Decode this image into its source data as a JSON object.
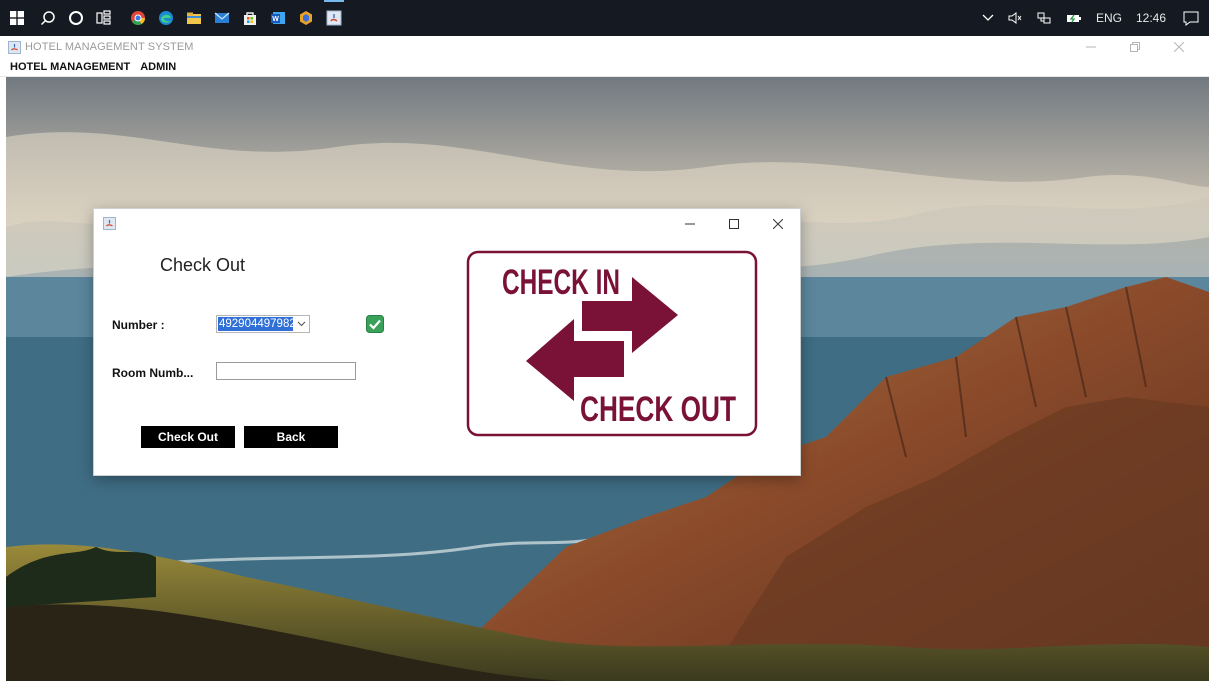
{
  "taskbar": {
    "tray": {
      "language": "ENG",
      "time": "12:46"
    }
  },
  "app": {
    "title": "HOTEL MANAGEMENT SYSTEM",
    "menu": [
      "HOTEL MANAGEMENT",
      "ADMIN"
    ]
  },
  "dialog": {
    "heading": "Check Out",
    "number_label": "Number :",
    "number_value": "492904497982",
    "room_label": "Room Numb...",
    "room_value": "",
    "checkout_button": "Check Out",
    "back_button": "Back",
    "banner": {
      "top_text": "CHECK IN",
      "bottom_text": "CHECK OUT"
    }
  },
  "colors": {
    "banner": "#7a1238",
    "selection": "#2f6fd6",
    "check_green": "#3aa15a",
    "taskbar": "#151a22"
  }
}
